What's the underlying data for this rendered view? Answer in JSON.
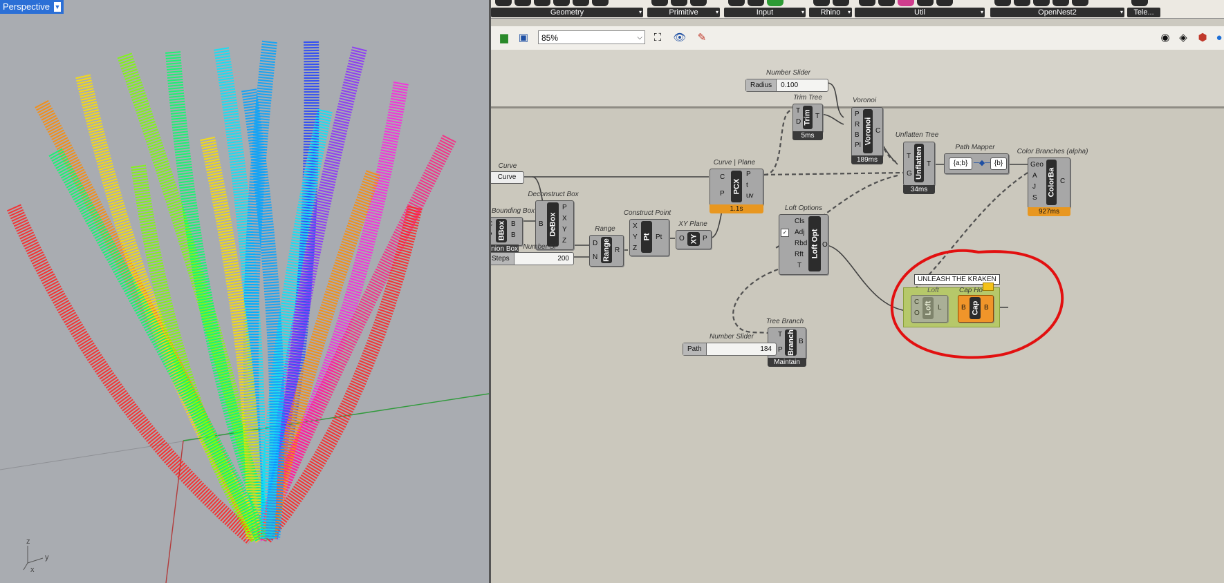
{
  "viewport": {
    "tab_label": "Perspective",
    "axis_labels": {
      "z": "z",
      "y": "y",
      "x": "x"
    }
  },
  "ribbon": {
    "groups": [
      {
        "label": "Geometry"
      },
      {
        "label": "Primitive"
      },
      {
        "label": "Input"
      },
      {
        "label": "Rhino"
      },
      {
        "label": "Util"
      },
      {
        "label": "OpenNest2"
      },
      {
        "label": "Tele..."
      }
    ]
  },
  "toolbar": {
    "zoom": "85%"
  },
  "components": {
    "number_slider_radius": {
      "title": "Number Slider",
      "name": "Radius",
      "value": "0.100"
    },
    "trim_tree": {
      "title": "Trim Tree",
      "nick": "Trim",
      "in": [
        "T",
        "D"
      ],
      "out": [
        "T"
      ],
      "time": "5ms"
    },
    "voronoi": {
      "title": "Voronoi",
      "nick": "Voronoi",
      "in": [
        "P",
        "R",
        "B",
        "Pl"
      ],
      "out": [
        "C"
      ],
      "time": "189ms"
    },
    "unflatten_tree": {
      "title": "Unflatten Tree",
      "nick": "Unflatten",
      "in": [
        "T",
        "G"
      ],
      "out": [
        "T"
      ],
      "time": "34ms"
    },
    "path_mapper": {
      "title": "Path Mapper",
      "source": "{a;b}",
      "target": "{b}"
    },
    "color_branches": {
      "title": "Color Branches (alpha)",
      "nick": "ColorBa",
      "in": [
        "Geo",
        "A",
        "J",
        "S"
      ],
      "out": [
        "C"
      ],
      "time": "927ms"
    },
    "curve_param": {
      "title": "Curve",
      "nick": "Curve"
    },
    "curve_plane": {
      "title": "Curve | Plane",
      "nick": "PCX",
      "in": [
        "C",
        "P"
      ],
      "out": [
        "P",
        "t",
        "uv"
      ],
      "time": "1.1s"
    },
    "bounding_box": {
      "title": "Bounding Box",
      "nick": "BBox",
      "in": [
        "C",
        "P"
      ],
      "out": [
        "B",
        "B"
      ],
      "footer": "Union Box"
    },
    "deconstruct_box": {
      "title": "Deconstruct Box",
      "nick": "DeBox",
      "in": [
        "B"
      ],
      "out": [
        "P",
        "X",
        "Y",
        "Z"
      ]
    },
    "steps_slider": {
      "title": "Number Sl",
      "name": "Steps",
      "value": "200"
    },
    "range": {
      "title": "Range",
      "nick": "Range",
      "in": [
        "D",
        "N"
      ],
      "out": [
        "R"
      ]
    },
    "construct_point": {
      "title": "Construct Point",
      "nick": "Pt",
      "in": [
        "X",
        "Y",
        "Z"
      ],
      "out": [
        "Pt"
      ]
    },
    "xy_plane": {
      "title": "XY Plane",
      "nick": "XY",
      "in": [
        "O"
      ],
      "out": [
        "P"
      ]
    },
    "loft_options": {
      "title": "Loft Options",
      "nick": "Loft Opt",
      "in": [
        "Cls",
        "Adj",
        "Rbd",
        "Rft",
        "T"
      ],
      "out": [
        "O"
      ]
    },
    "tree_branch": {
      "title": "Tree Branch",
      "nick": "Branch",
      "in": [
        "T",
        "P"
      ],
      "out": [
        "B"
      ],
      "footer": "Maintain"
    },
    "path_slider": {
      "title": "Number Slider",
      "name": "Path",
      "value": "184"
    },
    "group": {
      "tooltip": "UNLEASH THE KRAKEN",
      "loft_title": "Loft",
      "loft_nick": "Loft",
      "loft_in": [
        "C",
        "O"
      ],
      "loft_out": [
        "L"
      ],
      "cap_title": "Cap Ho",
      "cap_nick": "Cap",
      "cap_in": [
        "B"
      ],
      "cap_out": [
        "B"
      ]
    }
  }
}
